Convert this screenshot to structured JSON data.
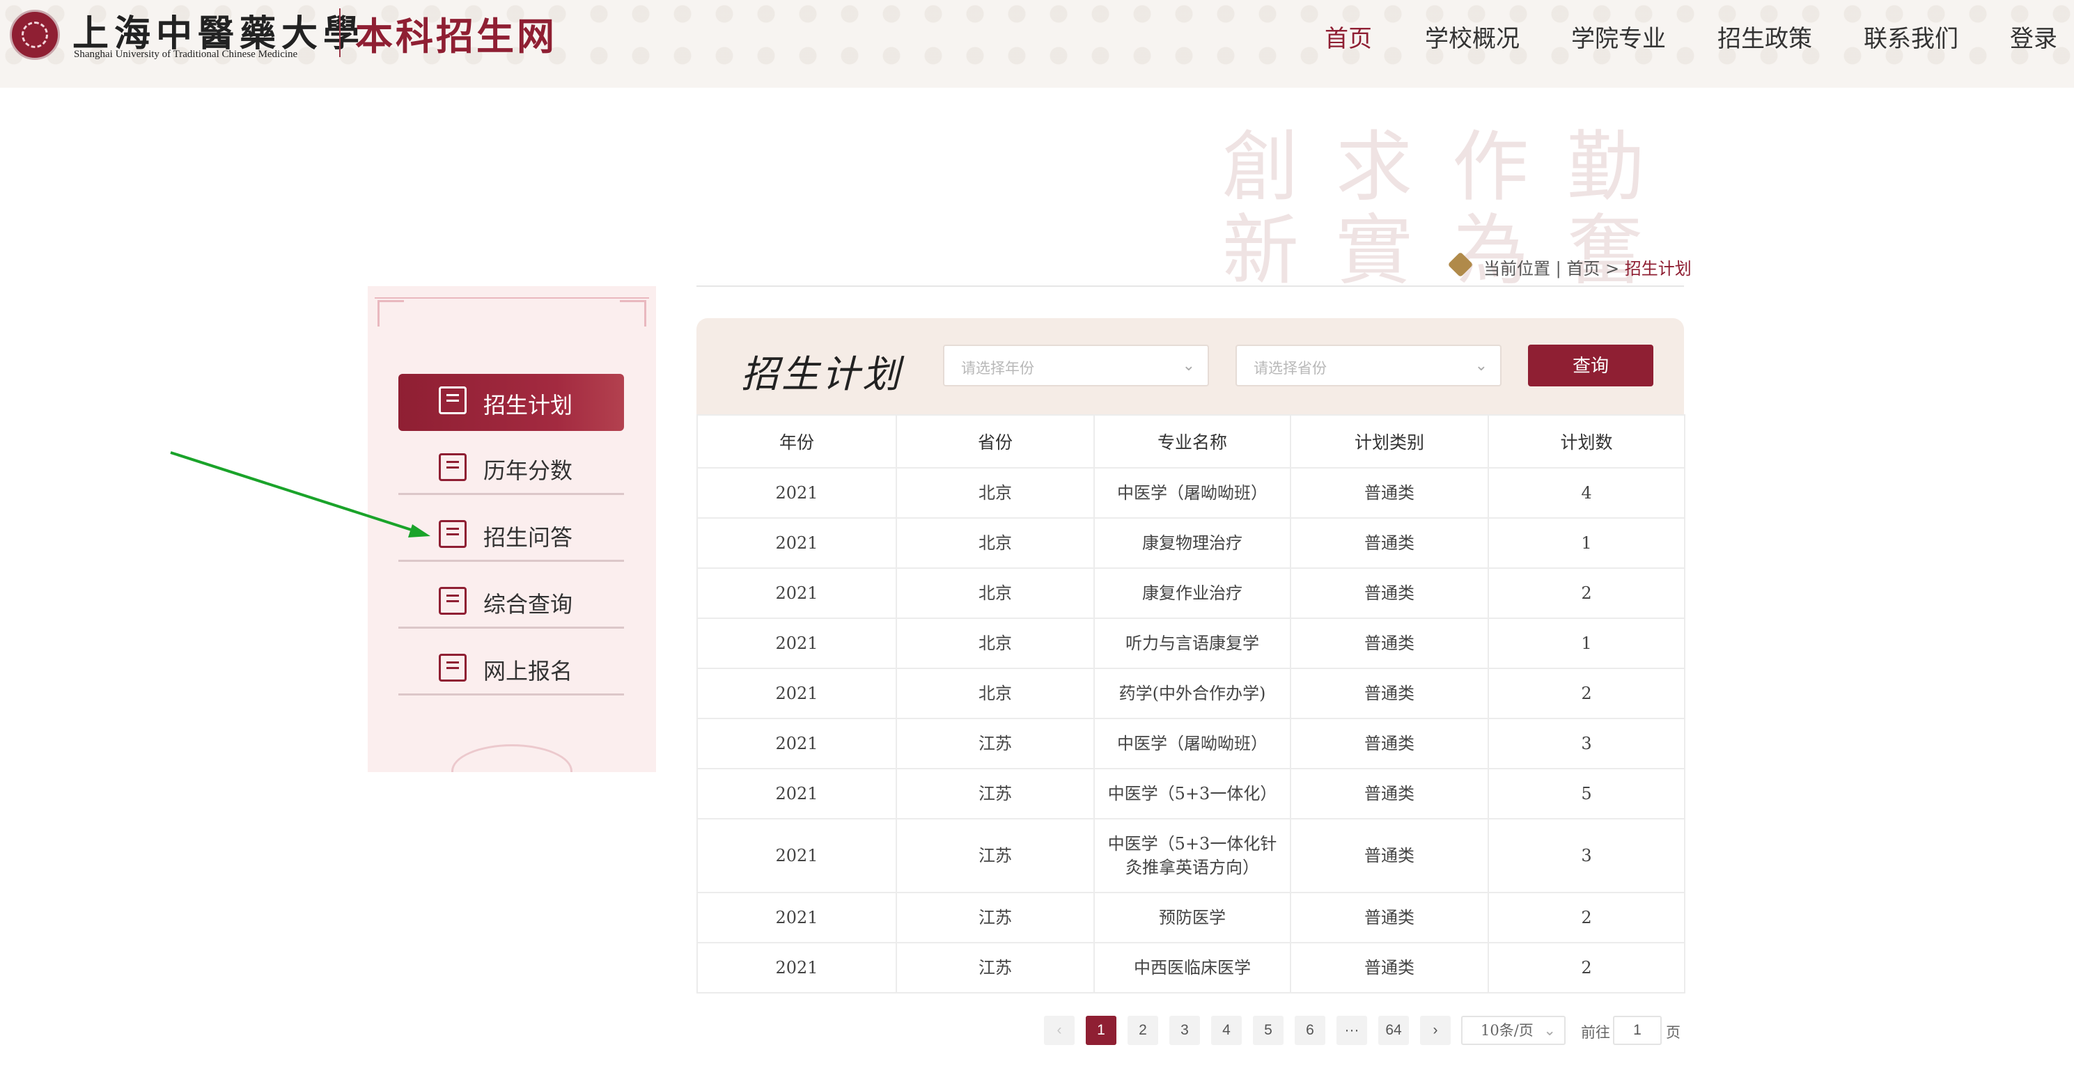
{
  "header": {
    "university_cn": "上海中醫藥大學",
    "university_en": "Shanghai University of Traditional Chinese Medicine",
    "site_title": "本科招生网",
    "nav": [
      {
        "label": "首页",
        "active": true
      },
      {
        "label": "学校概况"
      },
      {
        "label": "学院专业"
      },
      {
        "label": "招生政策"
      },
      {
        "label": "联系我们"
      },
      {
        "label": "登录"
      }
    ]
  },
  "breadcrumb": {
    "prefix": "当前位置",
    "separator": "|",
    "home": "首页",
    "arrow": ">",
    "current": "招生计划"
  },
  "sidebar": {
    "items": [
      {
        "label": "招生计划",
        "icon": "search-person-icon",
        "active": true
      },
      {
        "label": "历年分数",
        "icon": "score-card-icon"
      },
      {
        "label": "招生问答",
        "icon": "question-chat-icon"
      },
      {
        "label": "综合查询",
        "icon": "search-document-icon"
      },
      {
        "label": "网上报名",
        "icon": "pen-sign-icon"
      }
    ]
  },
  "query": {
    "title": "招生计划",
    "year_placeholder": "请选择年份",
    "province_placeholder": "请选择省份",
    "button": "查询"
  },
  "table": {
    "headers": [
      "年份",
      "省份",
      "专业名称",
      "计划类别",
      "计划数"
    ],
    "rows": [
      [
        "2021",
        "北京",
        "中医学（屠呦呦班）",
        "普通类",
        "4"
      ],
      [
        "2021",
        "北京",
        "康复物理治疗",
        "普通类",
        "1"
      ],
      [
        "2021",
        "北京",
        "康复作业治疗",
        "普通类",
        "2"
      ],
      [
        "2021",
        "北京",
        "听力与言语康复学",
        "普通类",
        "1"
      ],
      [
        "2021",
        "北京",
        "药学(中外合作办学)",
        "普通类",
        "2"
      ],
      [
        "2021",
        "江苏",
        "中医学（屠呦呦班）",
        "普通类",
        "3"
      ],
      [
        "2021",
        "江苏",
        "中医学（5+3一体化）",
        "普通类",
        "5"
      ],
      [
        "2021",
        "江苏",
        "中医学（5+3一体化针灸推拿英语方向）",
        "普通类",
        "3"
      ],
      [
        "2021",
        "江苏",
        "预防医学",
        "普通类",
        "2"
      ],
      [
        "2021",
        "江苏",
        "中西医临床医学",
        "普通类",
        "2"
      ]
    ]
  },
  "pagination": {
    "prev": "‹",
    "pages": [
      "1",
      "2",
      "3",
      "4",
      "5",
      "6",
      "···",
      "64"
    ],
    "current": "1",
    "next": "›",
    "page_size": "10条/页",
    "goto_prefix": "前往",
    "goto_value": "1",
    "goto_suffix": "页"
  },
  "colors": {
    "brand": "#8f1f33",
    "annotation_arrow": "#1aa32a"
  }
}
